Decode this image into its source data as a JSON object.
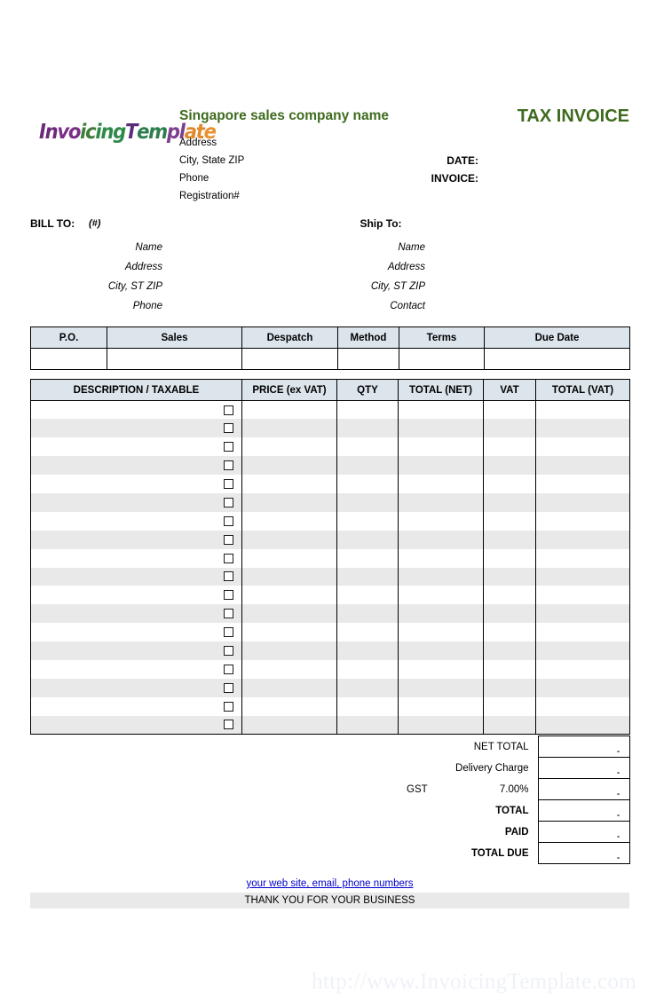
{
  "watermark": "http://www.InvoicingTemplate.com",
  "logo": {
    "parts": [
      {
        "text": "In",
        "cls": "lg1"
      },
      {
        "text": "vo",
        "cls": "lg2"
      },
      {
        "text": "ic",
        "cls": "lg3"
      },
      {
        "text": "ing",
        "cls": "lg4"
      },
      {
        "text": "T",
        "cls": "lg5"
      },
      {
        "text": "em",
        "cls": "lg6"
      },
      {
        "text": "pl",
        "cls": "lg7"
      },
      {
        "text": "at",
        "cls": "lg8"
      },
      {
        "text": "e",
        "cls": "lg9"
      }
    ],
    "full_text": "InvoicingTemplate"
  },
  "header": {
    "company_name": "Singapore sales company name",
    "company_lines": [
      "Address",
      "City, State ZIP",
      "Phone",
      "Registration#"
    ],
    "doc_title": "TAX INVOICE",
    "meta_labels": [
      "DATE:",
      "INVOICE:"
    ],
    "title_color": "#3f6b1e"
  },
  "bill_to": {
    "title": "BILL TO:",
    "hash": "(#)",
    "lines": [
      "Name",
      "Address",
      "City, ST ZIP",
      "Phone"
    ]
  },
  "ship_to": {
    "title": "Ship To:",
    "lines": [
      "Name",
      "Address",
      "City, ST ZIP",
      "Contact"
    ]
  },
  "ship_table": {
    "headers": [
      "P.O.",
      "Sales",
      "Despatch",
      "Method",
      "Terms",
      "Due Date"
    ],
    "values": [
      "",
      "",
      "",
      "",
      "",
      ""
    ]
  },
  "items_table": {
    "headers": [
      "DESCRIPTION / TAXABLE",
      "PRICE (ex VAT)",
      "QTY",
      "TOTAL (NET)",
      "VAT",
      "TOTAL (VAT)"
    ],
    "row_count": 18,
    "rows": [
      {
        "description": "",
        "taxable": false,
        "price": "",
        "qty": "",
        "total_net": "",
        "vat": "",
        "total_vat": ""
      },
      {
        "description": "",
        "taxable": false,
        "price": "",
        "qty": "",
        "total_net": "",
        "vat": "",
        "total_vat": ""
      },
      {
        "description": "",
        "taxable": false,
        "price": "",
        "qty": "",
        "total_net": "",
        "vat": "",
        "total_vat": ""
      },
      {
        "description": "",
        "taxable": false,
        "price": "",
        "qty": "",
        "total_net": "",
        "vat": "",
        "total_vat": ""
      },
      {
        "description": "",
        "taxable": false,
        "price": "",
        "qty": "",
        "total_net": "",
        "vat": "",
        "total_vat": ""
      },
      {
        "description": "",
        "taxable": false,
        "price": "",
        "qty": "",
        "total_net": "",
        "vat": "",
        "total_vat": ""
      },
      {
        "description": "",
        "taxable": false,
        "price": "",
        "qty": "",
        "total_net": "",
        "vat": "",
        "total_vat": ""
      },
      {
        "description": "",
        "taxable": false,
        "price": "",
        "qty": "",
        "total_net": "",
        "vat": "",
        "total_vat": ""
      },
      {
        "description": "",
        "taxable": false,
        "price": "",
        "qty": "",
        "total_net": "",
        "vat": "",
        "total_vat": ""
      },
      {
        "description": "",
        "taxable": false,
        "price": "",
        "qty": "",
        "total_net": "",
        "vat": "",
        "total_vat": ""
      },
      {
        "description": "",
        "taxable": false,
        "price": "",
        "qty": "",
        "total_net": "",
        "vat": "",
        "total_vat": ""
      },
      {
        "description": "",
        "taxable": false,
        "price": "",
        "qty": "",
        "total_net": "",
        "vat": "",
        "total_vat": ""
      },
      {
        "description": "",
        "taxable": false,
        "price": "",
        "qty": "",
        "total_net": "",
        "vat": "",
        "total_vat": ""
      },
      {
        "description": "",
        "taxable": false,
        "price": "",
        "qty": "",
        "total_net": "",
        "vat": "",
        "total_vat": ""
      },
      {
        "description": "",
        "taxable": false,
        "price": "",
        "qty": "",
        "total_net": "",
        "vat": "",
        "total_vat": ""
      },
      {
        "description": "",
        "taxable": false,
        "price": "",
        "qty": "",
        "total_net": "",
        "vat": "",
        "total_vat": ""
      },
      {
        "description": "",
        "taxable": false,
        "price": "",
        "qty": "",
        "total_net": "",
        "vat": "",
        "total_vat": ""
      },
      {
        "description": "",
        "taxable": false,
        "price": "",
        "qty": "",
        "total_net": "",
        "vat": "",
        "total_vat": ""
      }
    ]
  },
  "totals": {
    "net_total_label": "NET TOTAL",
    "net_total_value": "-",
    "delivery_label": "Delivery Charge",
    "delivery_value": "-",
    "gst_label": "GST",
    "gst_rate": "7.00%",
    "gst_value": "-",
    "total_label": "TOTAL",
    "total_value": "-",
    "paid_label": "PAID",
    "paid_value": "-",
    "total_due_label": "TOTAL DUE",
    "total_due_value": "-"
  },
  "footer": {
    "link": "your web site, email, phone numbers",
    "thanks": "THANK YOU FOR YOUR BUSINESS"
  },
  "colors": {
    "header_fill": "#dce5ec",
    "row_alt": "#e9e9e9",
    "brand_green": "#3f6b1e",
    "link_blue": "#0000cc"
  }
}
